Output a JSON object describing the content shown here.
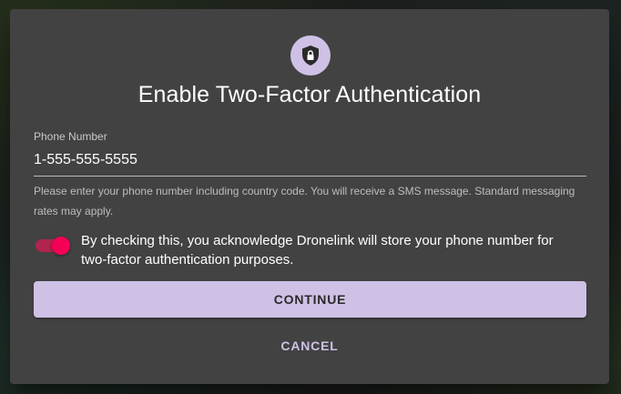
{
  "dialog": {
    "icon": "shield-lock-icon",
    "title": "Enable Two-Factor Authentication",
    "phone_field": {
      "label": "Phone Number",
      "value": "1-555-555-5555",
      "placeholder": ""
    },
    "helper_text": "Please enter your phone number including country code. You will receive a SMS message. Standard messaging rates may apply.",
    "consent": {
      "checked": true,
      "text": "By checking this, you acknowledge Dronelink will store your phone number for two-factor authentication purposes."
    },
    "continue_label": "CONTINUE",
    "cancel_label": "CANCEL"
  },
  "colors": {
    "dialog_bg": "#424242",
    "accent": "#cfc1e5",
    "switch_on": "#f50057"
  }
}
